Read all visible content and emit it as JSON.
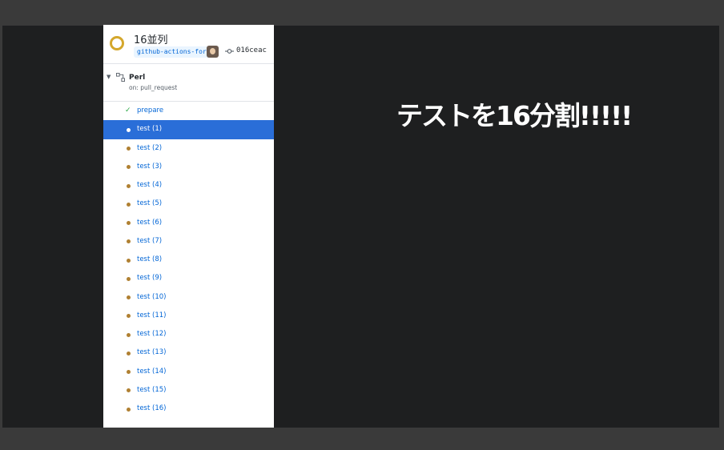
{
  "run": {
    "title": "16並列",
    "branch": "github-actions-for…",
    "commit_sha": "016ceac",
    "status_color": "#d4a72c"
  },
  "workflow": {
    "name": "Perl",
    "trigger": "on: pull_request"
  },
  "jobs": [
    {
      "label": "prepare",
      "status": "success"
    },
    {
      "label": "test (1)",
      "status": "in-progress",
      "selected": true
    },
    {
      "label": "test (2)",
      "status": "queued"
    },
    {
      "label": "test (3)",
      "status": "queued"
    },
    {
      "label": "test (4)",
      "status": "queued"
    },
    {
      "label": "test (5)",
      "status": "queued"
    },
    {
      "label": "test (6)",
      "status": "queued"
    },
    {
      "label": "test (7)",
      "status": "queued"
    },
    {
      "label": "test (8)",
      "status": "queued"
    },
    {
      "label": "test (9)",
      "status": "queued"
    },
    {
      "label": "test (10)",
      "status": "queued"
    },
    {
      "label": "test (11)",
      "status": "queued"
    },
    {
      "label": "test (12)",
      "status": "queued"
    },
    {
      "label": "test (13)",
      "status": "queued"
    },
    {
      "label": "test (14)",
      "status": "queued"
    },
    {
      "label": "test (15)",
      "status": "queued"
    },
    {
      "label": "test (16)",
      "status": "queued"
    }
  ],
  "headline": "テストを16分割!!!!!",
  "colors": {
    "selected_row": "#2a6ed8",
    "link": "#0366d6",
    "queued_dot": "#b08032",
    "success": "#28a745"
  }
}
